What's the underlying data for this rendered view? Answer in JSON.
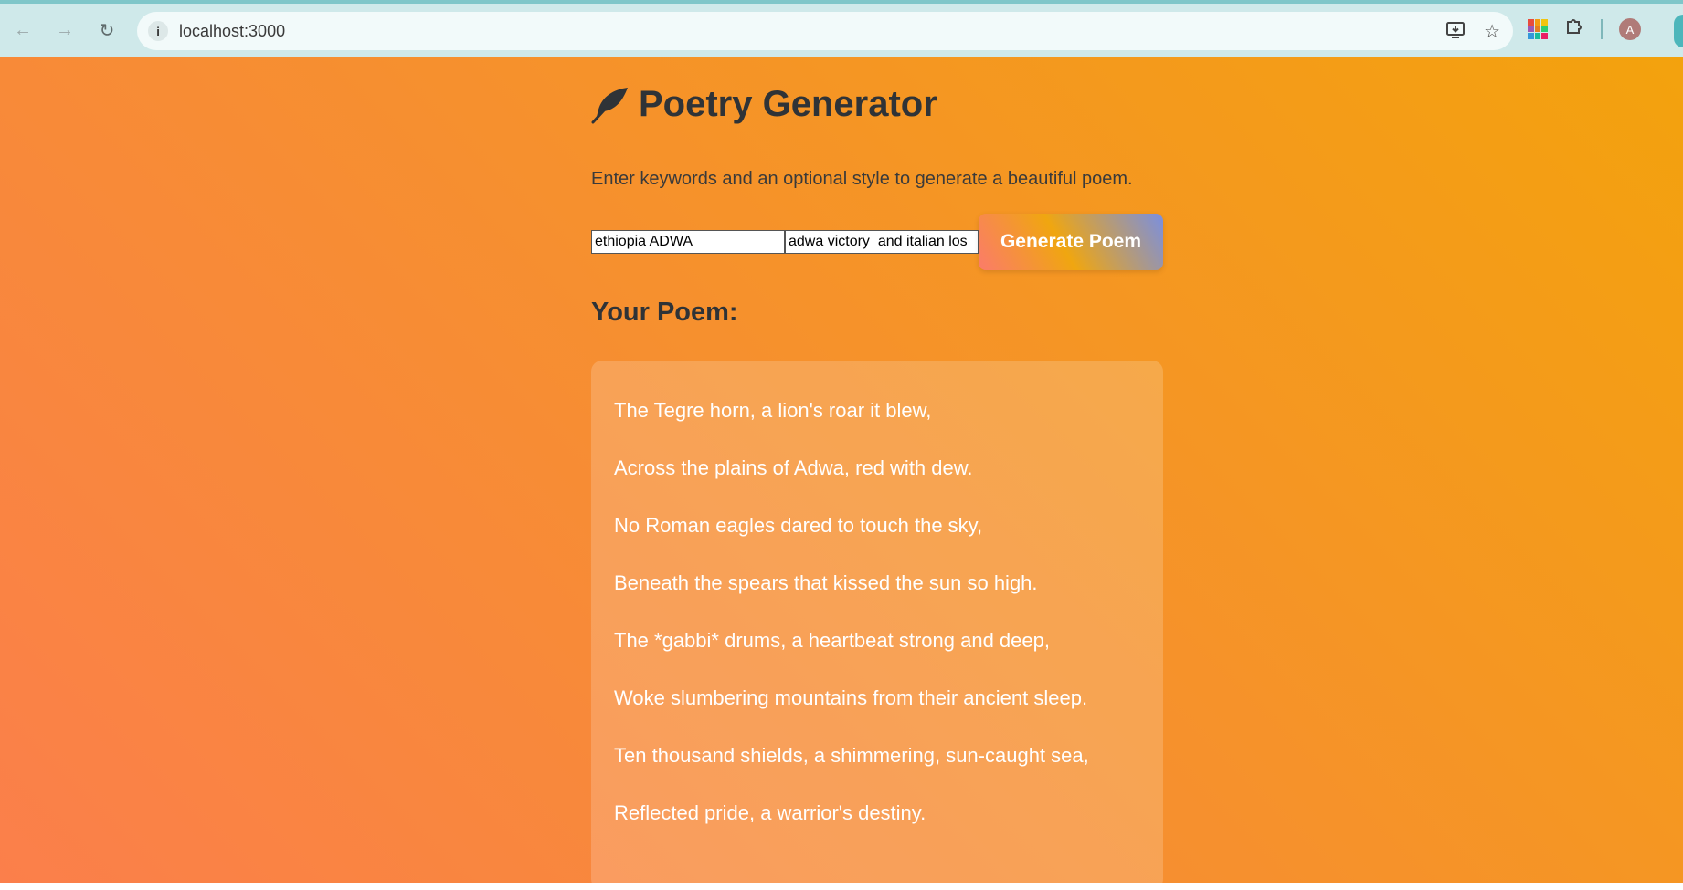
{
  "browser": {
    "url": "localhost:3000",
    "profile_initial": "A"
  },
  "header": {
    "title": "Poetry Generator",
    "icon": "feather-icon"
  },
  "subtitle": "Enter keywords and an optional style to generate a beautiful poem.",
  "form": {
    "keywords_value": "ethiopia ADWA",
    "style_value": "adwa victory  and italian los",
    "generate_label": "Generate Poem"
  },
  "poem": {
    "heading": "Your Poem:",
    "lines": [
      "The Tegre horn, a lion's roar it blew,",
      "Across the plains of Adwa, red with dew.",
      "No Roman eagles dared to touch the sky,",
      "Beneath the spears that kissed the sun so high.",
      "The *gabbi* drums, a heartbeat strong and deep,",
      "Woke slumbering mountains from their ancient sleep.",
      "Ten thousand shields, a shimmering, sun-caught sea,",
      "Reflected pride, a warrior's destiny."
    ]
  },
  "colors": {
    "page_gradient_start": "#fb7f4b",
    "page_gradient_end": "#f3a20d",
    "title_color": "#2f3337",
    "poem_text": "#ffffff"
  }
}
